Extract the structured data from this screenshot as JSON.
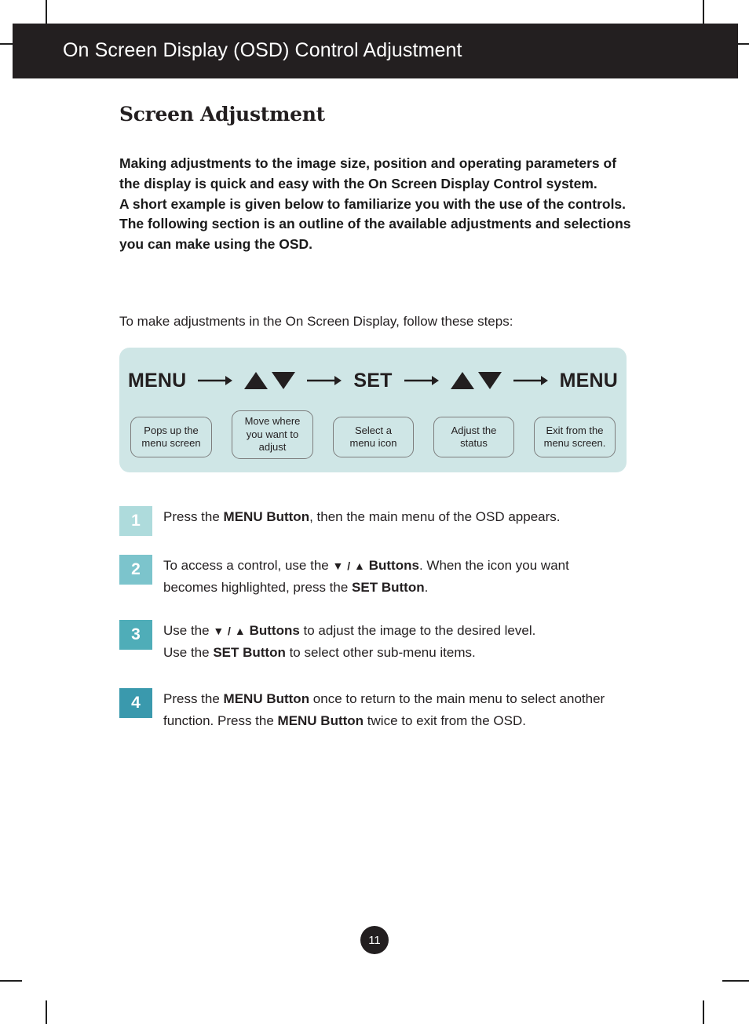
{
  "header": {
    "title": "On Screen Display (OSD) Control Adjustment",
    "bar_color": "#231f20"
  },
  "section": {
    "heading": "Screen Adjustment",
    "intro_paragraph_1": "Making adjustments to the image size, position and operating parameters of the display is quick and easy with the On Screen Display Control system.",
    "intro_paragraph_2": "A short example is given below to familiarize you with the use of the controls. The following section is an outline of the available adjustments and selections you can make using the OSD.",
    "lead_in": "To make adjustments in the On Screen Display, follow these steps:"
  },
  "diagram": {
    "panel_color": "#cfe6e6",
    "box_border_color": "#7d7d7d",
    "steps": [
      {
        "label": "MENU",
        "kind": "word",
        "caption": "Pops up the menu screen"
      },
      {
        "label": "▲▼",
        "kind": "triangles",
        "caption": "Move where you want to adjust"
      },
      {
        "label": "SET",
        "kind": "word",
        "caption": "Select a menu icon"
      },
      {
        "label": "▲▼",
        "kind": "triangles",
        "caption": "Adjust the status"
      },
      {
        "label": "MENU",
        "kind": "word",
        "caption": "Exit from the menu screen."
      }
    ]
  },
  "steps": [
    {
      "number": "1",
      "color": "#aedbdc",
      "lines": [
        [
          {
            "t": "Press the ",
            "b": false
          },
          {
            "t": "MENU Button",
            "b": true
          },
          {
            "t": ", then the main menu of the OSD appears.",
            "b": false
          }
        ]
      ]
    },
    {
      "number": "2",
      "color": "#7cc4cc",
      "lines": [
        [
          {
            "t": "To access a control, use the  ",
            "b": false
          },
          {
            "t": "▼ / ▲ ",
            "b": true
          },
          {
            "t": "Buttons",
            "b": true
          },
          {
            "t": ". When the icon you want",
            "b": false
          }
        ],
        [
          {
            "t": "becomes highlighted, press the  ",
            "b": false
          },
          {
            "t": "SET Button",
            "b": true
          },
          {
            "t": ".",
            "b": false
          }
        ]
      ]
    },
    {
      "number": "3",
      "color": "#4fadb8",
      "lines": [
        [
          {
            "t": "Use the  ",
            "b": false
          },
          {
            "t": "▼ / ▲ ",
            "b": true
          },
          {
            "t": "Buttons",
            "b": true
          },
          {
            "t": " to adjust the image to the desired level.",
            "b": false
          }
        ],
        [
          {
            "t": "Use the ",
            "b": false
          },
          {
            "t": "SET Button",
            "b": true
          },
          {
            "t": " to select other sub-menu items.",
            "b": false
          }
        ]
      ]
    },
    {
      "number": "4",
      "color": "#3a99ad",
      "lines": [
        [
          {
            "t": "Press the ",
            "b": false
          },
          {
            "t": "MENU Button",
            "b": true
          },
          {
            "t": " once to return to the main menu to select another",
            "b": false
          }
        ],
        [
          {
            "t": "function. Press the ",
            "b": false
          },
          {
            "t": "MENU Button",
            "b": true
          },
          {
            "t": " twice to exit from the OSD.",
            "b": false
          }
        ]
      ]
    }
  ],
  "footer": {
    "page_number": "11"
  }
}
